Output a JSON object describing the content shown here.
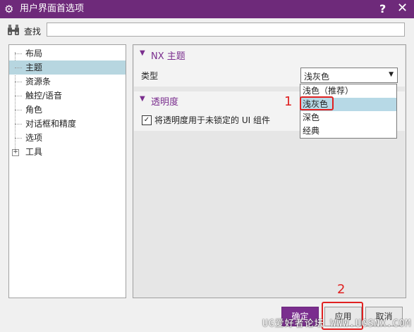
{
  "window": {
    "title": "用户界面首选项",
    "help_glyph": "?",
    "close_glyph": "✕",
    "settings_glyph": "⚙"
  },
  "search": {
    "label": "查找",
    "value": "",
    "placeholder": ""
  },
  "tree": {
    "items": [
      {
        "label": "布局"
      },
      {
        "label": "主题",
        "selected": true
      },
      {
        "label": "资源条"
      },
      {
        "label": "触控/语音"
      },
      {
        "label": "角色"
      },
      {
        "label": "对话框和精度"
      },
      {
        "label": "选项"
      },
      {
        "label": "工具",
        "expandable": true
      }
    ],
    "expander_glyph": "+"
  },
  "sections": {
    "theme": {
      "title": "NX 主题",
      "type_label": "类型",
      "type_value": "浅灰色",
      "collapse_glyph": "▼"
    },
    "transparency": {
      "title": "透明度",
      "checkbox_label": "将透明度用于未锁定的 UI 组件",
      "checked": true,
      "check_glyph": "✓",
      "collapse_glyph": "▼"
    }
  },
  "dropdown": {
    "options": [
      "浅色（推荐）",
      "浅灰色",
      "深色",
      "经典"
    ],
    "highlighted_index": 1,
    "arrow_glyph": "▼"
  },
  "annotations": {
    "marker_1": "1",
    "marker_2": "2",
    "highlight_color": "#e02020"
  },
  "buttons": {
    "ok": "确定",
    "apply": "应用",
    "cancel": "取消"
  },
  "watermark": "UG爱好者论坛 WWW.UGSNX.COM",
  "colors": {
    "title_bar": "#6e2a7a",
    "accent": "#7a2e8e",
    "selection": "#b7d6e0"
  }
}
